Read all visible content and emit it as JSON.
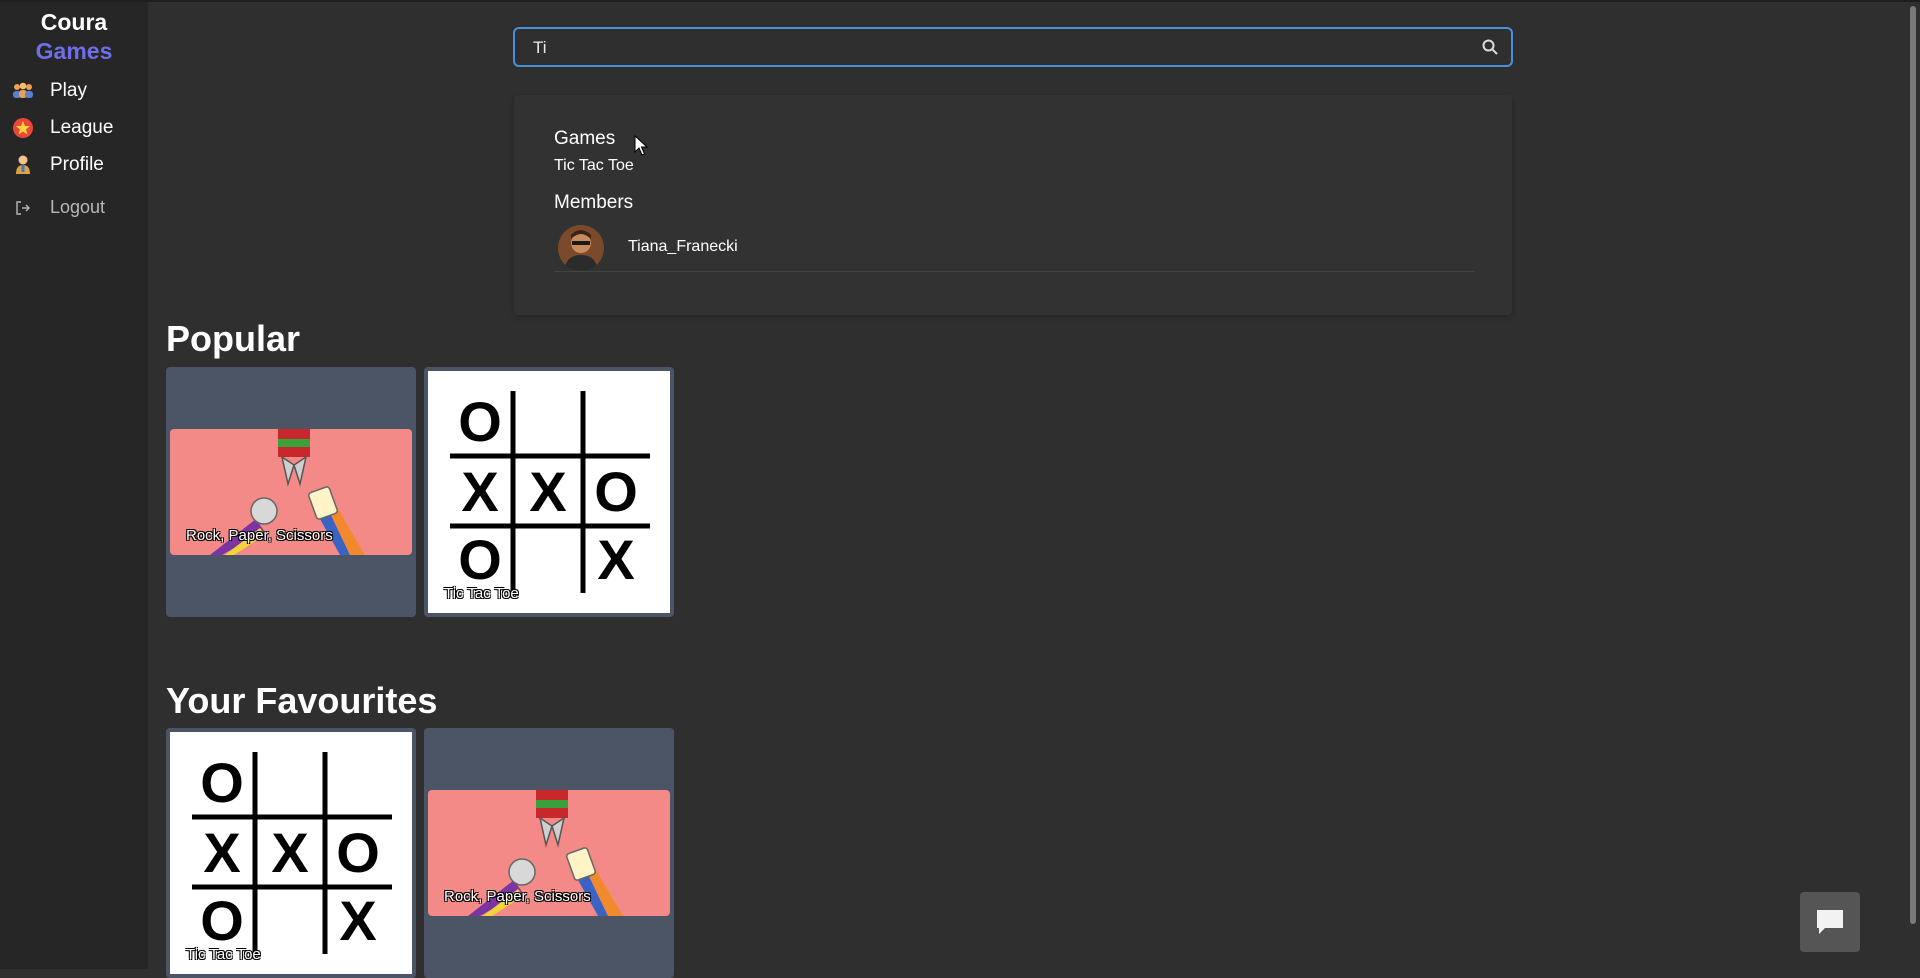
{
  "brand": {
    "line1": "Coura",
    "line2": "Games"
  },
  "nav": {
    "items": [
      {
        "label": "Play",
        "icon": "people-icon"
      },
      {
        "label": "League",
        "icon": "star-badge-icon"
      },
      {
        "label": "Profile",
        "icon": "person-icon"
      }
    ],
    "logout": {
      "label": "Logout",
      "icon": "logout-icon"
    }
  },
  "search": {
    "value": "Ti",
    "placeholder": ""
  },
  "results": {
    "games_heading": "Games",
    "games": [
      "Tic Tac Toe"
    ],
    "members_heading": "Members",
    "members": [
      {
        "name": "Tiana_Franecki"
      }
    ]
  },
  "popular": {
    "title": "Popular",
    "cards": [
      {
        "title": "Rock, Paper, Scissors",
        "kind": "rps"
      },
      {
        "title": "Tic Tac Toe",
        "kind": "ttt"
      }
    ]
  },
  "favourites": {
    "title": "Your Favourites",
    "cards": [
      {
        "title": "Tic Tac Toe",
        "kind": "ttt"
      },
      {
        "title": "Rock, Paper, Scissors",
        "kind": "rps"
      }
    ]
  },
  "tic_tac_toe_board": [
    "O",
    "",
    "",
    "X",
    "X",
    "O",
    "O",
    "",
    "X"
  ],
  "colors": {
    "accent": "#6e6ee8",
    "card_bg": "#4b5566",
    "rps_bg": "#f48a87",
    "search_border": "#4a90d9"
  },
  "chat": {
    "icon": "chat-bubble-icon"
  }
}
